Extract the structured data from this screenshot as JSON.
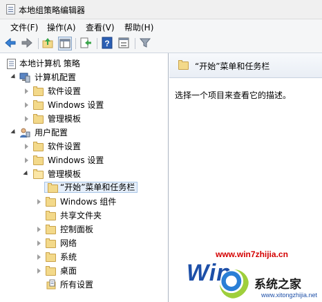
{
  "window": {
    "title": "本地组策略编辑器"
  },
  "menu": [
    {
      "label": "文件(F)"
    },
    {
      "label": "操作(A)"
    },
    {
      "label": "查看(V)"
    },
    {
      "label": "帮助(H)"
    }
  ],
  "toolbar": {
    "buttons": [
      {
        "icon": "back-arrow-icon"
      },
      {
        "icon": "forward-arrow-icon"
      },
      {
        "icon": "up-folder-icon"
      },
      {
        "icon": "show-hide-tree-icon"
      },
      {
        "icon": "export-list-icon"
      },
      {
        "icon": "help-icon"
      },
      {
        "icon": "properties-icon"
      },
      {
        "icon": "filter-icon"
      }
    ]
  },
  "tree": {
    "root": "本地计算机 策略",
    "computer_config": {
      "label": "计算机配置",
      "children": [
        "软件设置",
        "Windows 设置",
        "管理模板"
      ]
    },
    "user_config": {
      "label": "用户配置",
      "children": [
        "软件设置",
        "Windows 设置",
        "管理模板"
      ],
      "admin_templates_children": [
        "“开始”菜单和任务栏",
        "Windows 组件",
        "共享文件夹",
        "控制面板",
        "网络",
        "系统",
        "桌面",
        "所有设置"
      ]
    }
  },
  "detail": {
    "header": "“开始”菜单和任务栏",
    "description": "选择一个项目来查看它的描述。"
  },
  "watermark": {
    "url": "www.win7zhijia.cn",
    "logo": "Win",
    "brand": "系统之家",
    "small": "www.xitongzhijia.net"
  },
  "colors": {
    "accent": "#1d4fa8",
    "selection": "#e6effa",
    "folder": "#f3d98a",
    "watermark_red": "#d40000"
  }
}
